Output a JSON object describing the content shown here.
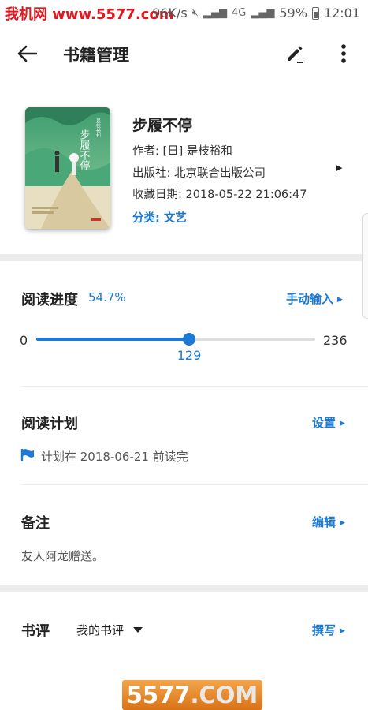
{
  "watermark": {
    "top": "我机网 www.5577.com",
    "bottom_prefix": "5577",
    "bottom_suffix": ".COM"
  },
  "status_bar": {
    "speed": "96K/s",
    "battery": "59%",
    "time": "12:01",
    "net": "4G"
  },
  "app_bar": {
    "title": "书籍管理"
  },
  "book": {
    "title": "步履不停",
    "author": "作者: [日] 是枝裕和",
    "publisher": "出版社: 北京联合出版公司",
    "date": "收藏日期: 2018-05-22 21:06:47",
    "category": "分类: 文艺",
    "cover_title": "步履不停",
    "cover_author": "是枝裕和"
  },
  "reading_progress": {
    "title": "阅读进度",
    "percent_text": "54.7%",
    "manual_label": "手动输入",
    "min": "0",
    "max": "236",
    "current": "129",
    "fraction": 0.547
  },
  "reading_plan": {
    "title": "阅读计划",
    "action_label": "设置",
    "plan_text": "计划在 2018-06-21 前读完"
  },
  "notes": {
    "title": "备注",
    "action_label": "编辑",
    "text": "友人阿龙赠送。"
  },
  "review": {
    "title": "书评",
    "selected": "我的书评",
    "action_label": "撰写"
  },
  "colors": {
    "accent": "#1c7ad6",
    "watermark_red": "#e4161d"
  }
}
